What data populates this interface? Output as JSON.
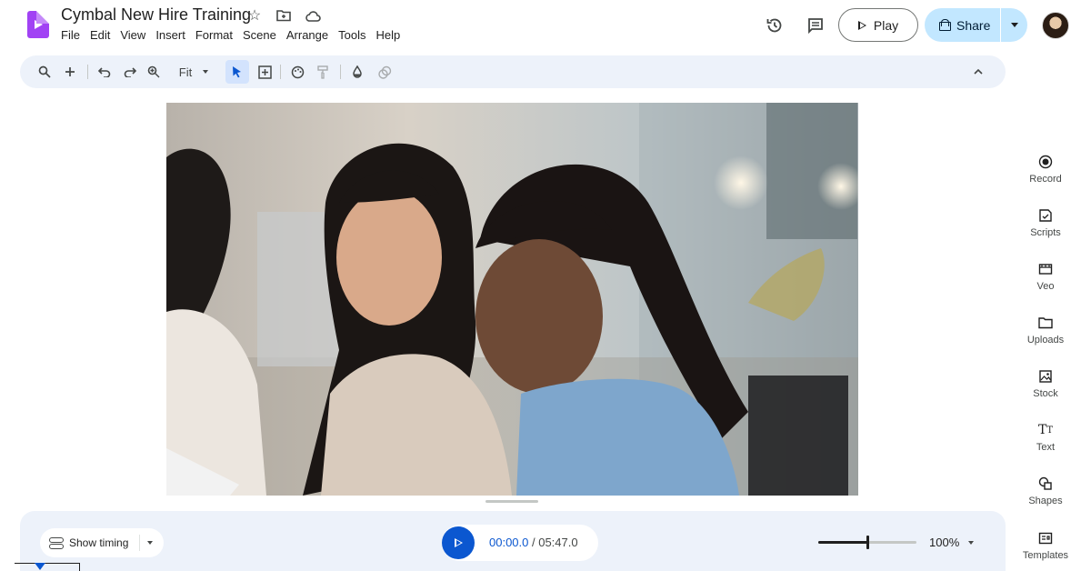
{
  "app": {
    "title": "Cymbal New Hire Training",
    "icons": [
      "star-icon",
      "move-to-folder-icon",
      "cloud-saved-icon"
    ]
  },
  "menu": [
    "File",
    "Edit",
    "View",
    "Insert",
    "Format",
    "Scene",
    "Arrange",
    "Tools",
    "Help"
  ],
  "header": {
    "play_label": "Play",
    "share_label": "Share",
    "icons": [
      "version-history-icon",
      "comments-icon",
      "account-avatar"
    ]
  },
  "toolbar": {
    "zoom_fit_label": "Fit",
    "tools": [
      "search-icon",
      "add-icon",
      "undo-icon",
      "redo-icon",
      "zoom-icon",
      "select-icon",
      "add-text-box-icon",
      "theme-palette-icon",
      "paint-format-icon",
      "fill-color-icon",
      "effects-icon",
      "collapse-toolbar-icon"
    ]
  },
  "side_panel": [
    {
      "label": "Record",
      "icon": "record-icon"
    },
    {
      "label": "Scripts",
      "icon": "scripts-icon"
    },
    {
      "label": "Veo",
      "icon": "veo-icon"
    },
    {
      "label": "Uploads",
      "icon": "folder-icon"
    },
    {
      "label": "Stock",
      "icon": "stock-image-icon"
    },
    {
      "label": "Text",
      "icon": "text-icon"
    },
    {
      "label": "Shapes",
      "icon": "shapes-icon"
    },
    {
      "label": "Templates",
      "icon": "templates-icon"
    }
  ],
  "bottom": {
    "show_timing_label": "Show timing",
    "time_current": "00:00.0",
    "time_separator": " / ",
    "time_total": "05:47.0",
    "zoom_value": "100%",
    "zoom_slider_fraction": 0.5
  },
  "colors": {
    "accent": "#0b57d0",
    "share_bg": "#c2e7ff",
    "toolbar_bg": "#edf2fa",
    "logo": "#a142f4"
  }
}
